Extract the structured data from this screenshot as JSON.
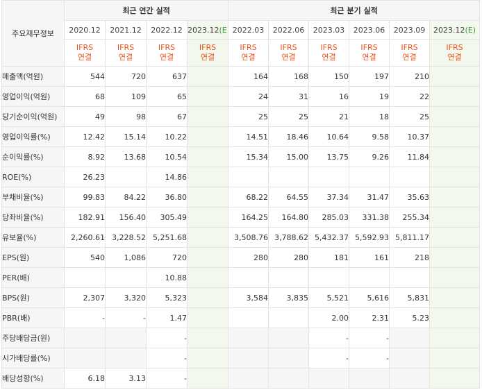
{
  "corner_label": "주요재무정보",
  "groups": {
    "annual": "최근 연간 실적",
    "quarterly": "최근 분기 실적"
  },
  "annual_periods": [
    {
      "period": "2020.12",
      "estimate": ""
    },
    {
      "period": "2021.12",
      "estimate": ""
    },
    {
      "period": "2022.12",
      "estimate": ""
    },
    {
      "period": "2023.12",
      "estimate": "(E)"
    }
  ],
  "quarter_periods": [
    {
      "period": "2022.03",
      "estimate": ""
    },
    {
      "period": "2022.06",
      "estimate": ""
    },
    {
      "period": "2023.03",
      "estimate": ""
    },
    {
      "period": "2023.06",
      "estimate": ""
    },
    {
      "period": "2023.09",
      "estimate": ""
    },
    {
      "period": "2023.12",
      "estimate": "(E)"
    }
  ],
  "ifrs": {
    "line1": "IFRS",
    "line2": "연결"
  },
  "rows": [
    {
      "label": "매출액(억원)",
      "values": [
        "544",
        "720",
        "637",
        "",
        "164",
        "168",
        "150",
        "197",
        "210",
        ""
      ]
    },
    {
      "label": "영업이익(억원)",
      "values": [
        "68",
        "109",
        "65",
        "",
        "24",
        "31",
        "16",
        "19",
        "22",
        ""
      ]
    },
    {
      "label": "당기순이익(억원)",
      "values": [
        "49",
        "98",
        "67",
        "",
        "25",
        "25",
        "21",
        "18",
        "25",
        ""
      ]
    },
    {
      "label": "영업이익률(%)",
      "values": [
        "12.42",
        "15.14",
        "10.22",
        "",
        "14.51",
        "18.46",
        "10.64",
        "9.58",
        "10.37",
        ""
      ]
    },
    {
      "label": "순이익률(%)",
      "values": [
        "8.92",
        "13.68",
        "10.54",
        "",
        "15.34",
        "15.00",
        "13.75",
        "9.26",
        "11.84",
        ""
      ]
    },
    {
      "label": "ROE(%)",
      "values": [
        "26.23",
        "",
        "14.86",
        "",
        "",
        "",
        "",
        "",
        "",
        ""
      ]
    },
    {
      "label": "부채비율(%)",
      "values": [
        "99.83",
        "84.22",
        "36.80",
        "",
        "68.22",
        "64.55",
        "37.34",
        "31.47",
        "35.63",
        ""
      ]
    },
    {
      "label": "당좌비율(%)",
      "values": [
        "182.91",
        "156.40",
        "305.49",
        "",
        "164.25",
        "164.80",
        "285.03",
        "331.38",
        "255.34",
        ""
      ]
    },
    {
      "label": "유보율(%)",
      "values": [
        "2,260.61",
        "3,228.52",
        "5,251.68",
        "",
        "3,508.76",
        "3,788.62",
        "5,432.37",
        "5,592.93",
        "5,811.17",
        ""
      ]
    },
    {
      "label": "EPS(원)",
      "values": [
        "540",
        "1,086",
        "720",
        "",
        "280",
        "280",
        "181",
        "161",
        "218",
        ""
      ]
    },
    {
      "label": "PER(배)",
      "values": [
        "",
        "",
        "10.88",
        "",
        "",
        "",
        "",
        "",
        "",
        ""
      ]
    },
    {
      "label": "BPS(원)",
      "values": [
        "2,307",
        "3,320",
        "5,323",
        "",
        "3,584",
        "3,835",
        "5,521",
        "5,616",
        "5,831",
        ""
      ]
    },
    {
      "label": "PBR(배)",
      "values": [
        "-",
        "-",
        "1.47",
        "",
        "",
        "",
        "2.00",
        "2.31",
        "5.23",
        ""
      ]
    },
    {
      "label": "주당배당금(원)",
      "values": [
        "",
        "",
        "-",
        "",
        "",
        "",
        "-",
        "-",
        "",
        ""
      ]
    },
    {
      "label": "시가배당률(%)",
      "values": [
        "",
        "",
        "-",
        "",
        "",
        "",
        "-",
        "-",
        "",
        ""
      ]
    },
    {
      "label": "배당성향(%)",
      "values": [
        "6.18",
        "3.13",
        "-",
        "",
        "",
        "",
        "",
        "",
        "",
        ""
      ]
    }
  ]
}
